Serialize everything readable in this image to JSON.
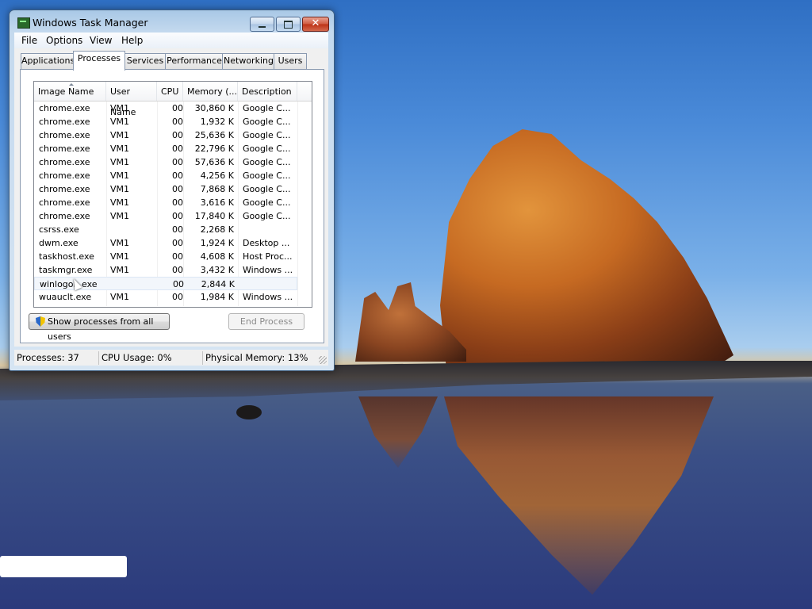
{
  "window": {
    "title": "Windows Task Manager",
    "menu": [
      "File",
      "Options",
      "View",
      "Help"
    ],
    "tabs": [
      "Applications",
      "Processes",
      "Services",
      "Performance",
      "Networking",
      "Users"
    ],
    "active_tab": "Processes"
  },
  "columns": [
    "Image Name",
    "User Name",
    "CPU",
    "Memory (...",
    "Description"
  ],
  "processes": [
    {
      "name": "chrome.exe",
      "user": "VM1",
      "cpu": "00",
      "mem": "30,860 K",
      "desc": "Google C..."
    },
    {
      "name": "chrome.exe",
      "user": "VM1",
      "cpu": "00",
      "mem": "1,932 K",
      "desc": "Google C..."
    },
    {
      "name": "chrome.exe",
      "user": "VM1",
      "cpu": "00",
      "mem": "25,636 K",
      "desc": "Google C..."
    },
    {
      "name": "chrome.exe",
      "user": "VM1",
      "cpu": "00",
      "mem": "22,796 K",
      "desc": "Google C..."
    },
    {
      "name": "chrome.exe",
      "user": "VM1",
      "cpu": "00",
      "mem": "57,636 K",
      "desc": "Google C..."
    },
    {
      "name": "chrome.exe",
      "user": "VM1",
      "cpu": "00",
      "mem": "4,256 K",
      "desc": "Google C..."
    },
    {
      "name": "chrome.exe",
      "user": "VM1",
      "cpu": "00",
      "mem": "7,868 K",
      "desc": "Google C..."
    },
    {
      "name": "chrome.exe",
      "user": "VM1",
      "cpu": "00",
      "mem": "3,616 K",
      "desc": "Google C..."
    },
    {
      "name": "chrome.exe",
      "user": "VM1",
      "cpu": "00",
      "mem": "17,840 K",
      "desc": "Google C..."
    },
    {
      "name": "csrss.exe",
      "user": "",
      "cpu": "00",
      "mem": "2,268 K",
      "desc": ""
    },
    {
      "name": "dwm.exe",
      "user": "VM1",
      "cpu": "00",
      "mem": "1,924 K",
      "desc": "Desktop ..."
    },
    {
      "name": "taskhost.exe",
      "user": "VM1",
      "cpu": "00",
      "mem": "4,608 K",
      "desc": "Host Proc..."
    },
    {
      "name": "taskmgr.exe",
      "user": "VM1",
      "cpu": "00",
      "mem": "3,432 K",
      "desc": "Windows ..."
    },
    {
      "name": "winlogon.exe",
      "user": "",
      "cpu": "00",
      "mem": "2,844 K",
      "desc": ""
    },
    {
      "name": "wuauclt.exe",
      "user": "VM1",
      "cpu": "00",
      "mem": "1,984 K",
      "desc": "Windows ..."
    }
  ],
  "hovered_row": 13,
  "buttons": {
    "show_all": "Show processes from all users",
    "end_process": "End Process"
  },
  "status": {
    "processes": "Processes: 37",
    "cpu": "CPU Usage: 0%",
    "memory": "Physical Memory: 13%"
  },
  "colors": {
    "titlebar": "#c4d9ee",
    "close_button": "#c7432a",
    "desktop_sky": "#4a8ad8"
  }
}
